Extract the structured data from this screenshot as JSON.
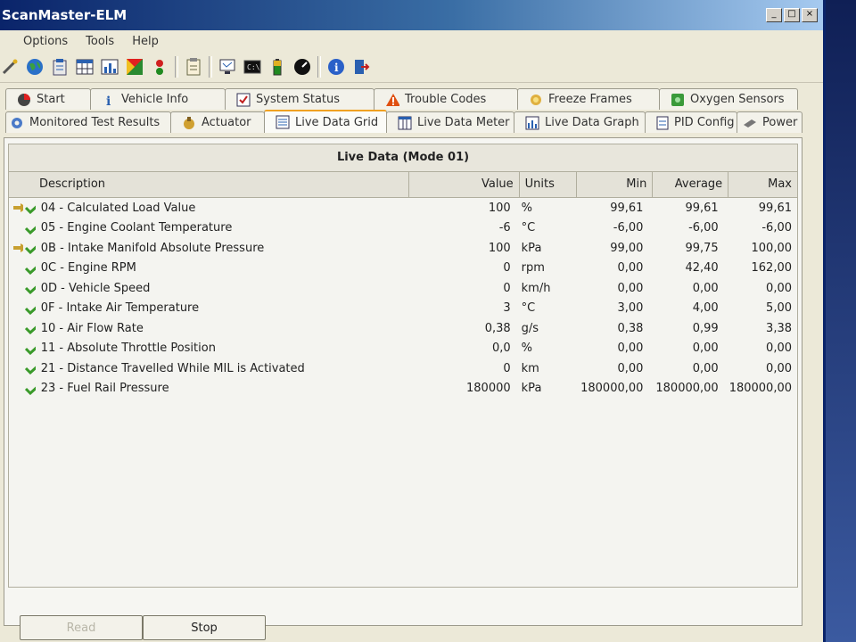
{
  "window": {
    "title": "ScanMaster-ELM",
    "controls": [
      "_",
      "□",
      "×"
    ]
  },
  "menu": [
    "Options",
    "Tools",
    "Help"
  ],
  "toolbar": {
    "icons": [
      "wand-icon",
      "globe-icon",
      "clipboard-icon",
      "grid-icon",
      "chart-icon",
      "pie-icon",
      "traffic-light-icon",
      "notepad-icon",
      "monitor-icon",
      "terminal-icon",
      "battery-icon",
      "gauge-icon",
      "info-icon",
      "exit-icon"
    ]
  },
  "tabs_row1": [
    {
      "label": "Start",
      "icon": "start-icon"
    },
    {
      "label": "Vehicle Info",
      "icon": "info-icon"
    },
    {
      "label": "System Status",
      "icon": "checklist-icon"
    },
    {
      "label": "Trouble Codes",
      "icon": "warning-icon"
    },
    {
      "label": "Freeze Frames",
      "icon": "snowflake-icon"
    },
    {
      "label": "Oxygen Sensors",
      "icon": "sensor-icon"
    }
  ],
  "tabs_row2": [
    {
      "label": "Monitored Test Results",
      "icon": "gear-icon",
      "active": false
    },
    {
      "label": "Actuator",
      "icon": "actuator-icon",
      "active": false
    },
    {
      "label": "Live Data Grid",
      "icon": "list-icon",
      "active": true
    },
    {
      "label": "Live Data Meter",
      "icon": "meter-icon",
      "active": false
    },
    {
      "label": "Live Data Graph",
      "icon": "graph-icon",
      "active": false
    },
    {
      "label": "PID Config",
      "icon": "config-icon",
      "active": false
    },
    {
      "label": "Power",
      "icon": "power-icon",
      "active": false
    }
  ],
  "grid": {
    "title": "Live Data (Mode 01)",
    "columns": {
      "description": "Description",
      "value": "Value",
      "units": "Units",
      "min": "Min",
      "average": "Average",
      "max": "Max"
    },
    "rows": [
      {
        "desc": "04 - Calculated Load Value",
        "value": "100",
        "units": "%",
        "min": "99,61",
        "avg": "99,61",
        "max": "99,61",
        "arrow": true
      },
      {
        "desc": "05 - Engine Coolant Temperature",
        "value": "-6",
        "units": "°C",
        "min": "-6,00",
        "avg": "-6,00",
        "max": "-6,00",
        "arrow": false
      },
      {
        "desc": "0B - Intake Manifold Absolute Pressure",
        "value": "100",
        "units": "kPa",
        "min": "99,00",
        "avg": "99,75",
        "max": "100,00",
        "arrow": true
      },
      {
        "desc": "0C - Engine RPM",
        "value": "0",
        "units": "rpm",
        "min": "0,00",
        "avg": "42,40",
        "max": "162,00",
        "arrow": false
      },
      {
        "desc": "0D - Vehicle Speed",
        "value": "0",
        "units": "km/h",
        "min": "0,00",
        "avg": "0,00",
        "max": "0,00",
        "arrow": false
      },
      {
        "desc": "0F - Intake Air Temperature",
        "value": "3",
        "units": "°C",
        "min": "3,00",
        "avg": "4,00",
        "max": "5,00",
        "arrow": false
      },
      {
        "desc": "10 - Air Flow Rate",
        "value": "0,38",
        "units": "g/s",
        "min": "0,38",
        "avg": "0,99",
        "max": "3,38",
        "arrow": false
      },
      {
        "desc": "11 - Absolute Throttle Position",
        "value": "0,0",
        "units": "%",
        "min": "0,00",
        "avg": "0,00",
        "max": "0,00",
        "arrow": false
      },
      {
        "desc": "21 - Distance Travelled While MIL is Activated",
        "value": "0",
        "units": "km",
        "min": "0,00",
        "avg": "0,00",
        "max": "0,00",
        "arrow": false
      },
      {
        "desc": "23 - Fuel Rail Pressure",
        "value": "180000",
        "units": "kPa",
        "min": "180000,00",
        "avg": "180000,00",
        "max": "180000,00",
        "arrow": false
      }
    ]
  },
  "buttons": {
    "read": "Read",
    "stop": "Stop"
  },
  "colors": {
    "titlebar": "#0a246a",
    "active_tab_accent": "#f0a020",
    "check": "#3a9a2a",
    "arrow": "#c8a030"
  }
}
